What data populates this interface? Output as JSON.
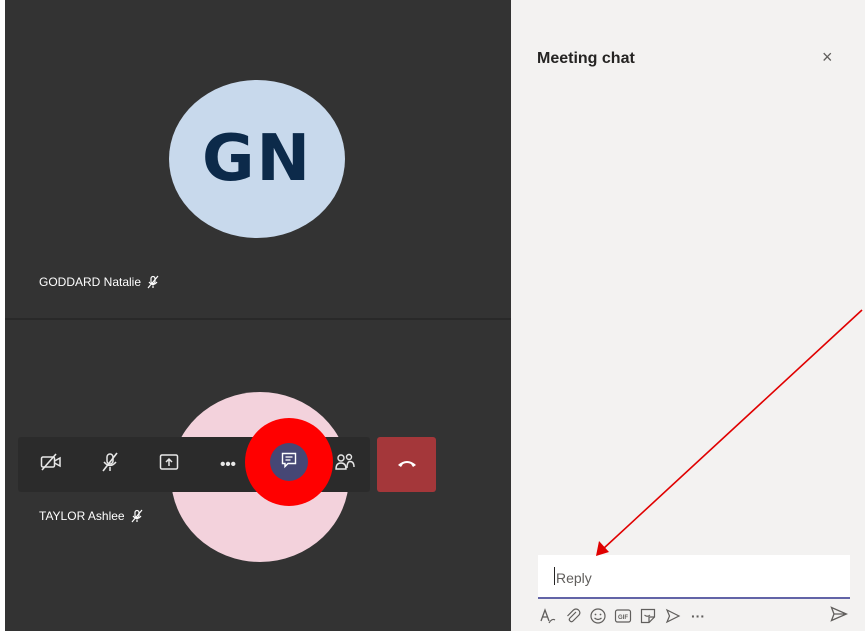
{
  "participants": [
    {
      "initials": "GN",
      "name": "GODDARD Natalie",
      "muted": true
    },
    {
      "initials": "",
      "name": "TAYLOR Ashlee",
      "muted": true
    }
  ],
  "toolbar": {
    "buttons": [
      {
        "icon": "camera-off-icon"
      },
      {
        "icon": "mic-off-icon"
      },
      {
        "icon": "share-screen-icon"
      },
      {
        "icon": "more-options-icon",
        "glyph": "•••"
      },
      {
        "icon": "chat-icon",
        "active": true
      },
      {
        "icon": "participants-icon"
      },
      {
        "icon": "hang-up-icon"
      }
    ]
  },
  "chat_panel": {
    "title": "Meeting chat",
    "close_glyph": "×",
    "reply_placeholder": "Reply",
    "compose_tools": [
      "format-icon",
      "attach-icon",
      "emoji-icon",
      "gif-icon",
      "sticker-icon",
      "praise-icon",
      "more-icon"
    ],
    "more_glyph": "···"
  },
  "colors": {
    "stage_bg": "#333333",
    "panel_bg": "#f3f2f1",
    "hangup": "#a4373a",
    "accent": "#6264a7",
    "highlight": "#ff0000"
  }
}
